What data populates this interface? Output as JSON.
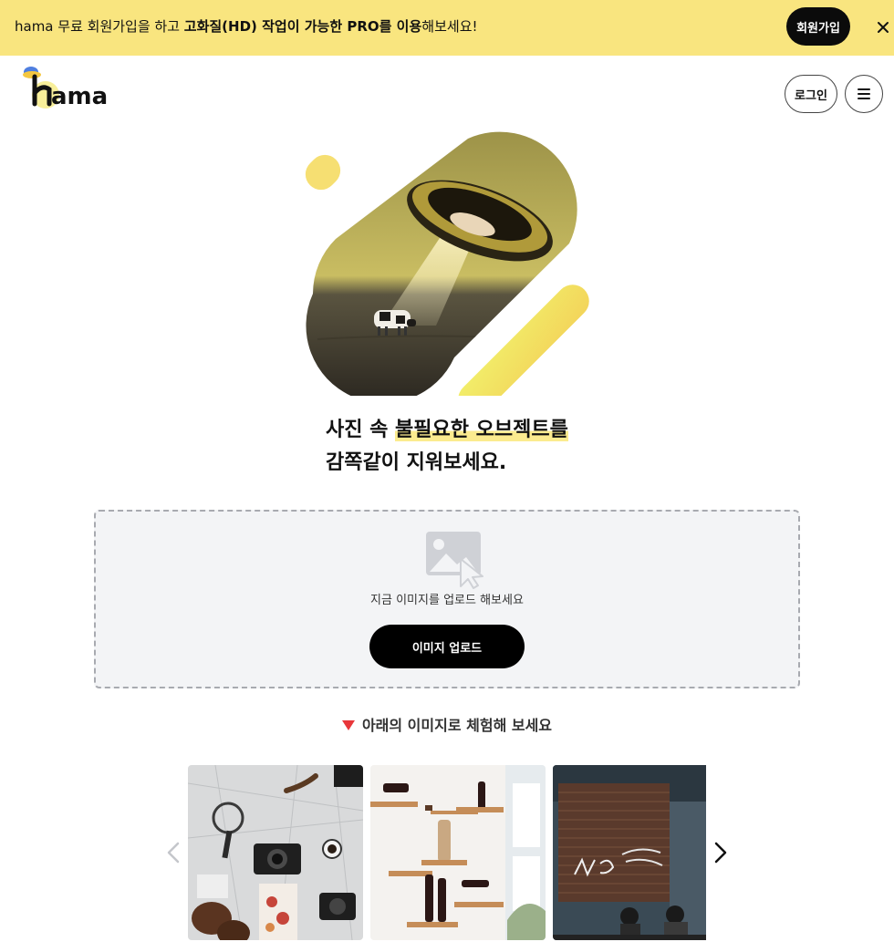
{
  "promo": {
    "text_lead": "hama 무료 회원가입을 하고 ",
    "text_bold": "고화질(HD) 작업이 가능한 PRO를 이용",
    "text_tail": "해보세요!",
    "signup_label": "회원가입",
    "close_icon": "close-icon"
  },
  "header": {
    "logo_text": "hama",
    "login_label": "로그인",
    "menu_icon": "hamburger-menu-icon"
  },
  "hero": {
    "headline_line1_plain": "사진 속 ",
    "headline_line1_highlight": "불필요한 오브젝트를",
    "headline_line2": "감쪽같이 지워보세요."
  },
  "upload": {
    "icon": "image-upload-icon",
    "hint": "지금 이미지를 업로드 해보세요",
    "button_label": "이미지 업로드"
  },
  "samples": {
    "heading": "아래의 이미지로 체험해 보세요",
    "prev_icon": "chevron-left-icon",
    "next_icon": "chevron-right-icon",
    "items": [
      "sample-travel-flatlay",
      "sample-wine-shelves",
      "sample-graffiti-wall"
    ]
  },
  "colors": {
    "banner": "#f9e57f",
    "accent_yellow": "#f5e35a",
    "button_dark": "#000000",
    "arrow_red": "#e8373a"
  }
}
